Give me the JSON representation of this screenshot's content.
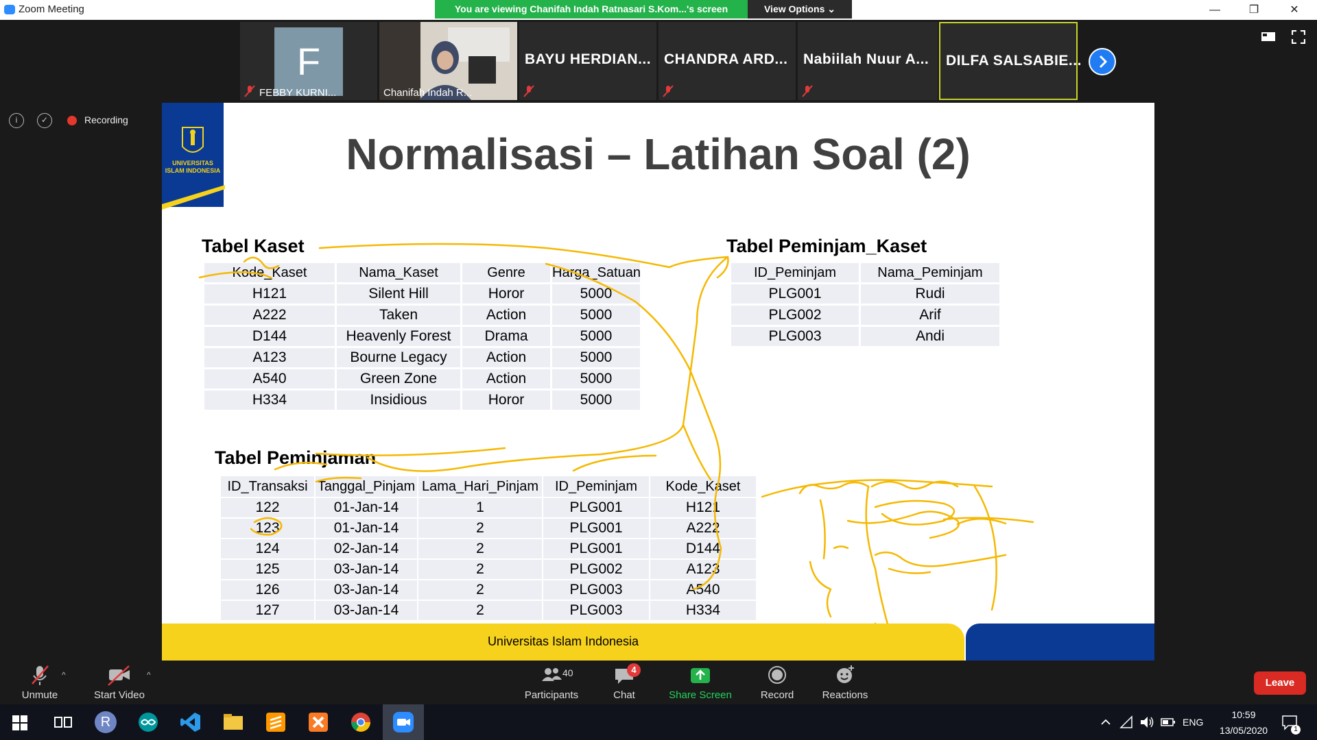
{
  "window": {
    "title": "Zoom Meeting",
    "minimize": "—",
    "restore": "❐",
    "close": "✕"
  },
  "share_banner": {
    "text": "You are viewing Chanifah Indah Ratnasari S.Kom...'s screen",
    "view_options": "View Options ⌄"
  },
  "participants": [
    {
      "initial": "F",
      "label": "FEBBY KURNI..."
    },
    {
      "label": "Chanifah Indah R..."
    },
    {
      "name": "BAYU  HERDIAN..."
    },
    {
      "name": "CHANDRA  ARD..."
    },
    {
      "name": "Nabiilah Nuur A..."
    },
    {
      "name": "DILFA  SALSABIE..."
    }
  ],
  "overlay": {
    "recording": "Recording",
    "info": "i"
  },
  "slide": {
    "logo_text": "UNIVERSITAS ISLAM INDONESIA",
    "title": "Normalisasi – Latihan Soal (2)",
    "footer": "Universitas Islam Indonesia",
    "kaset": {
      "title": "Tabel Kaset",
      "headers": [
        "Kode_Kaset",
        "Nama_Kaset",
        "Genre",
        "Harga_Satuan"
      ],
      "rows": [
        [
          "H121",
          "Silent Hill",
          "Horor",
          "5000"
        ],
        [
          "A222",
          "Taken",
          "Action",
          "5000"
        ],
        [
          "D144",
          "Heavenly Forest",
          "Drama",
          "5000"
        ],
        [
          "A123",
          "Bourne Legacy",
          "Action",
          "5000"
        ],
        [
          "A540",
          "Green Zone",
          "Action",
          "5000"
        ],
        [
          "H334",
          "Insidious",
          "Horor",
          "5000"
        ]
      ]
    },
    "peminjam": {
      "title": "Tabel Peminjam_Kaset",
      "headers": [
        "ID_Peminjam",
        "Nama_Peminjam"
      ],
      "rows": [
        [
          "PLG001",
          "Rudi"
        ],
        [
          "PLG002",
          "Arif"
        ],
        [
          "PLG003",
          "Andi"
        ]
      ]
    },
    "peminjaman": {
      "title": "Tabel Peminjaman",
      "headers": [
        "ID_Transaksi",
        "Tanggal_Pinjam",
        "Lama_Hari_Pinjam",
        "ID_Peminjam",
        "Kode_Kaset"
      ],
      "rows": [
        [
          "122",
          "01-Jan-14",
          "1",
          "PLG001",
          "H121"
        ],
        [
          "123",
          "01-Jan-14",
          "2",
          "PLG001",
          "A222"
        ],
        [
          "124",
          "02-Jan-14",
          "2",
          "PLG001",
          "D144"
        ],
        [
          "125",
          "03-Jan-14",
          "2",
          "PLG002",
          "A123"
        ],
        [
          "126",
          "03-Jan-14",
          "2",
          "PLG003",
          "A540"
        ],
        [
          "127",
          "03-Jan-14",
          "2",
          "PLG003",
          "H334"
        ]
      ]
    }
  },
  "toolbar": {
    "unmute": "Unmute",
    "start_video": "Start Video",
    "participants": "Participants",
    "participants_count": "40",
    "chat": "Chat",
    "chat_badge": "4",
    "share_screen": "Share Screen",
    "record": "Record",
    "reactions": "Reactions",
    "leave": "Leave"
  },
  "taskbar": {
    "language": "ENG",
    "time": "10:59",
    "date": "13/05/2020",
    "notification_count": "1",
    "r_app_letter": "R"
  },
  "colors": {
    "accent": "#2d8cff",
    "banner": "#24b24b",
    "ink": "#f5b800",
    "leave": "#d92a23",
    "uii_blue": "#0a3a93",
    "uii_yellow": "#f7d21c"
  }
}
